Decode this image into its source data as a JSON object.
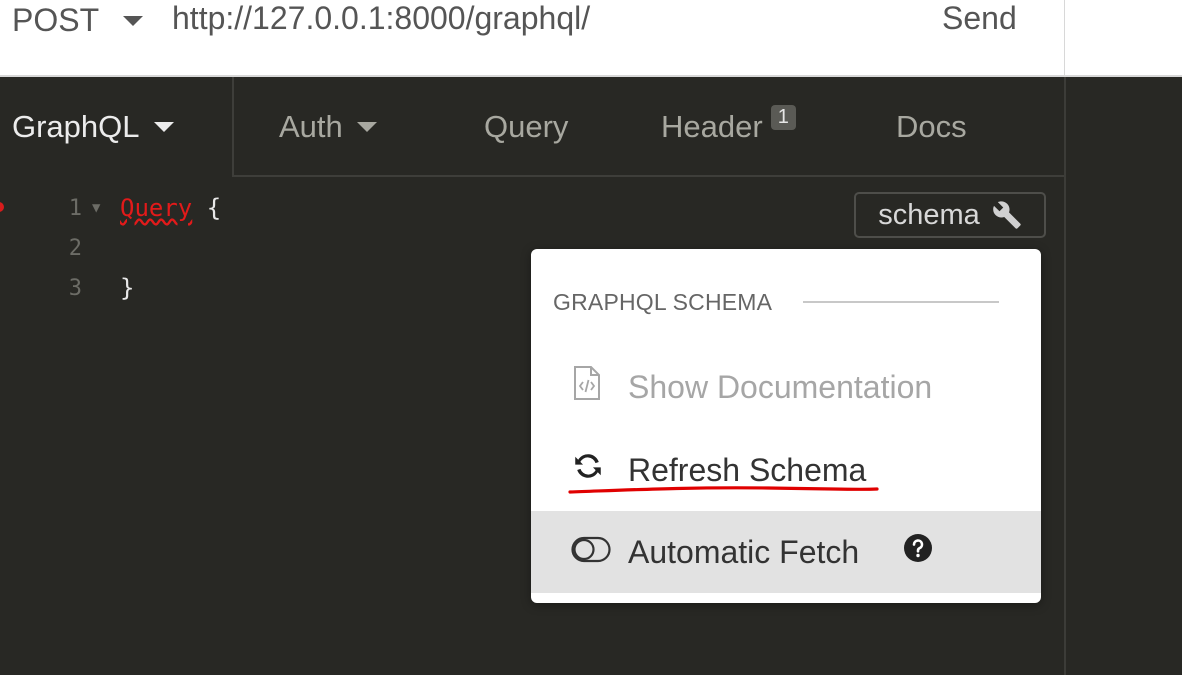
{
  "request": {
    "method": "POST",
    "url": "http://127.0.0.1:8000/graphql/",
    "send_label": "Send"
  },
  "tabs": [
    {
      "label": "GraphQL",
      "has_caret": true,
      "active": true
    },
    {
      "label": "Auth",
      "has_caret": true
    },
    {
      "label": "Query"
    },
    {
      "label": "Header",
      "badge": "1"
    },
    {
      "label": "Docs"
    }
  ],
  "editor": {
    "lines": [
      {
        "num": "1",
        "keyword": "Query",
        "rest": " {"
      },
      {
        "num": "2",
        "keyword": "",
        "rest": ""
      },
      {
        "num": "3",
        "keyword": "",
        "rest": "}"
      }
    ]
  },
  "schema_button": {
    "label": "schema",
    "icon": "wrench-icon"
  },
  "dropdown": {
    "title": "GRAPHQL SCHEMA",
    "items": [
      {
        "label": "Show Documentation",
        "icon": "file-code-icon",
        "state": "disabled"
      },
      {
        "label": "Refresh Schema",
        "icon": "refresh-icon",
        "state": "normal"
      },
      {
        "label": "Automatic Fetch",
        "icon": "toggle-off-icon",
        "state": "hover",
        "help_icon": "question-circle-icon"
      }
    ]
  },
  "colors": {
    "editor_bg": "#282824",
    "keyword_error": "#e21a1a",
    "annotation_underline": "#e00000"
  }
}
